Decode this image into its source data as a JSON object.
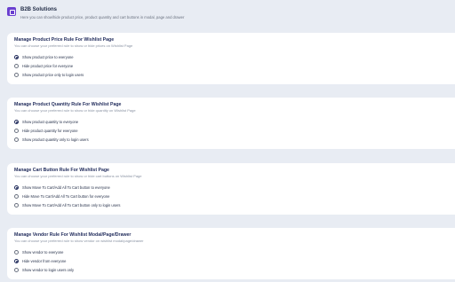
{
  "header": {
    "title": "B2B Solutions",
    "subtitle": "Here you can show/hide product price, product quantity and cart buttons in modal, page and drawer",
    "icon": "b2b-icon"
  },
  "accent": "#6a3fd0",
  "sections": [
    {
      "title": "Manage Product Price Rule For Wishlist Page",
      "description": "You can choose your preferred rule to show or hide prices on Wishlist Page",
      "options": [
        {
          "label": "Show product price to everyone",
          "selected": true
        },
        {
          "label": "Hide product price for everyone",
          "selected": false
        },
        {
          "label": "Show product price only to login users",
          "selected": false
        }
      ]
    },
    {
      "title": "Manage Product Quantity Rule For Wishlist Page",
      "description": "You can choose your preferred rule to show or hide quantity on Wishlist Page",
      "options": [
        {
          "label": "Show product quantity to everyone",
          "selected": true
        },
        {
          "label": "Hide product quantity for everyone",
          "selected": false
        },
        {
          "label": "Show product quantity only to login users",
          "selected": false
        }
      ]
    },
    {
      "title": "Manage Cart Button Rule For Wishlist Page",
      "description": "You can choose your preferred rule to show or hide cart buttons on Wishlist Page",
      "options": [
        {
          "label": "Show Move To Cart/Add All To Cart button to everyone",
          "selected": true
        },
        {
          "label": "Hide Move To Cart/Add All To Cart button for everyone",
          "selected": false
        },
        {
          "label": "Show Move To Cart/Add All To Cart button only to login users",
          "selected": false
        }
      ]
    },
    {
      "title": "Manage Vendor Rule For Wishlist Modal/Page/Drawer",
      "description": "You can choose your preferred rule to show vendor on wishlist modal/page/drawer",
      "options": [
        {
          "label": "Show vendor to everyone",
          "selected": false
        },
        {
          "label": "Hide vendor from everyone",
          "selected": true
        },
        {
          "label": "Show vendor to login users only",
          "selected": false
        }
      ]
    }
  ]
}
